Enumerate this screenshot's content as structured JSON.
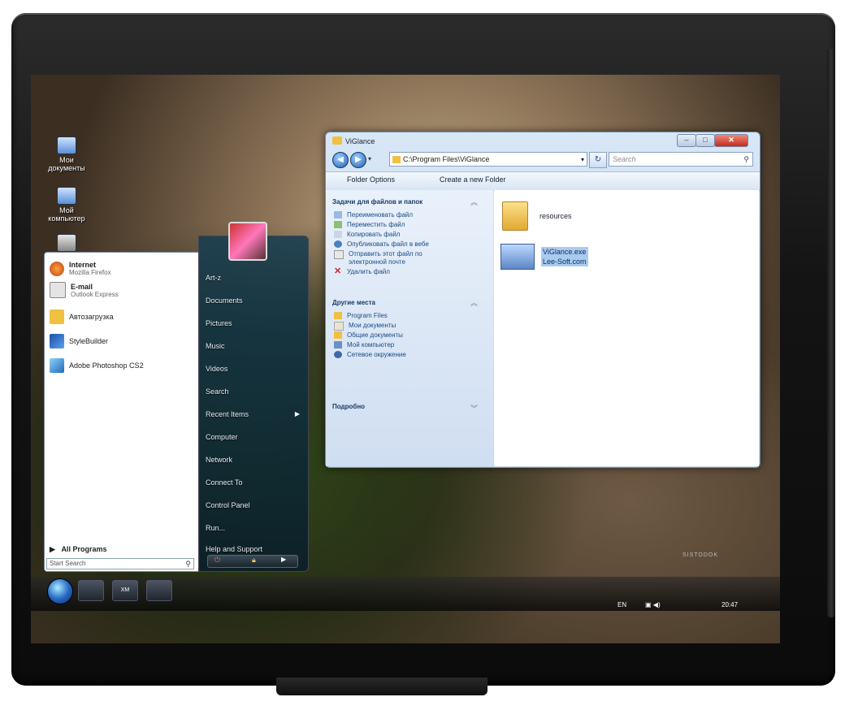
{
  "desktop": {
    "icons": [
      {
        "label": "Мои\nдокументы",
        "icon": "documents-icon"
      },
      {
        "label": "Мой\nкомпьютер",
        "icon": "computer-icon"
      },
      {
        "label": "",
        "icon": "recycle-bin-icon"
      }
    ]
  },
  "start_menu": {
    "pinned": [
      {
        "title": "Internet",
        "subtitle": "Mozilla Firefox",
        "icon": "firefox-icon"
      },
      {
        "title": "E-mail",
        "subtitle": "Outlook Express",
        "icon": "email-icon"
      }
    ],
    "recent": [
      {
        "label": "Автозагрузка",
        "icon": "folder-icon"
      },
      {
        "label": "StyleBuilder",
        "icon": "stylebuilder-icon"
      },
      {
        "label": "Adobe Photoshop CS2",
        "icon": "photoshop-icon"
      }
    ],
    "all_programs": "All Programs",
    "search_placeholder": "Start Search",
    "right_links": [
      "Art-z",
      "Documents",
      "Pictures",
      "Music",
      "Videos",
      "Search",
      "Recent Items",
      "Computer",
      "Network",
      "Connect To",
      "Control Panel",
      "Run...",
      "Help and Support"
    ]
  },
  "explorer": {
    "title": "ViGlance",
    "address": "C:\\Program Files\\ViGlance",
    "search_placeholder": "Search",
    "toolbar": {
      "folder_options": "Folder Options",
      "new_folder": "Create a new Folder"
    },
    "task_groups": [
      {
        "heading": "Задачи для файлов и папок",
        "items": [
          "Переименовать файл",
          "Переместить файл",
          "Копировать файл",
          "Опубликовать файл в вебе",
          "Отправить этот файл по электронной почте",
          "Удалить файл"
        ]
      },
      {
        "heading": "Другие места",
        "items": [
          "Program Files",
          "Мои документы",
          "Общие документы",
          "Мой компьютер",
          "Сетевое окружение"
        ]
      },
      {
        "heading": "Подробно",
        "items": []
      }
    ],
    "files": [
      {
        "name": "resources",
        "type": "folder"
      },
      {
        "name": "ViGlance.exe",
        "subtitle": "Lee-Soft.com",
        "type": "exe"
      }
    ]
  },
  "taskbar": {
    "apps": [
      {
        "label": "",
        "icon": "computer-icon"
      },
      {
        "label": "XM",
        "icon": "xm-icon"
      },
      {
        "label": "",
        "icon": "photoshop-icon"
      }
    ],
    "clock": "20:47",
    "lang": "EN"
  },
  "brand": "SISTODOK"
}
